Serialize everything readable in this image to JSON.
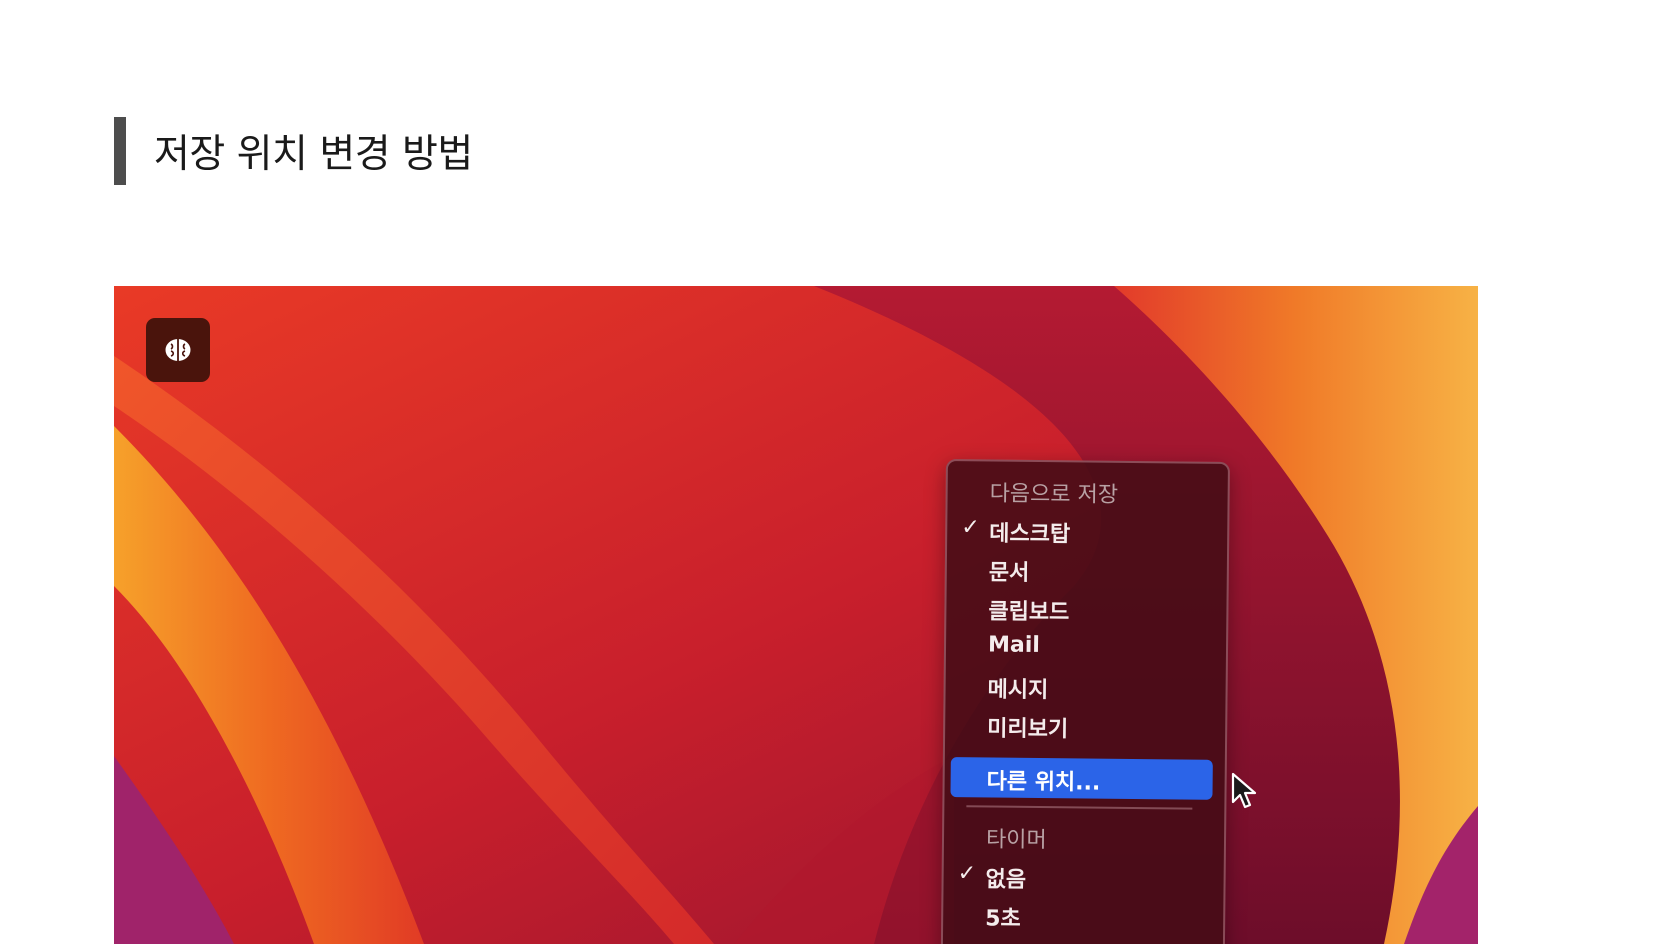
{
  "article": {
    "cut_paragraph": "· · · · · · · · · · · · · · · · · · · · · · · · · · · · · · · · · · · · · · · · · · · · · · · · · · · · · · ·",
    "section_heading": "저장 위치 변경 방법"
  },
  "screenshot": {
    "badge_icon": "brain-icon",
    "menu": {
      "save_section_label": "다음으로 저장",
      "save_items": [
        {
          "label": "데스크탑",
          "checked": true
        },
        {
          "label": "문서",
          "checked": false
        },
        {
          "label": "클립보드",
          "checked": false
        },
        {
          "label": "Mail",
          "checked": false
        },
        {
          "label": "메시지",
          "checked": false
        },
        {
          "label": "미리보기",
          "checked": false
        },
        {
          "label": "다른 위치...",
          "checked": false,
          "highlighted": true
        }
      ],
      "timer_section_label": "타이머",
      "timer_items": [
        {
          "label": "없음",
          "checked": true
        },
        {
          "label": "5초",
          "checked": false
        }
      ],
      "check_glyph": "✓"
    },
    "colors": {
      "highlight": "#2b64e8",
      "badge": "#4a140c"
    }
  }
}
